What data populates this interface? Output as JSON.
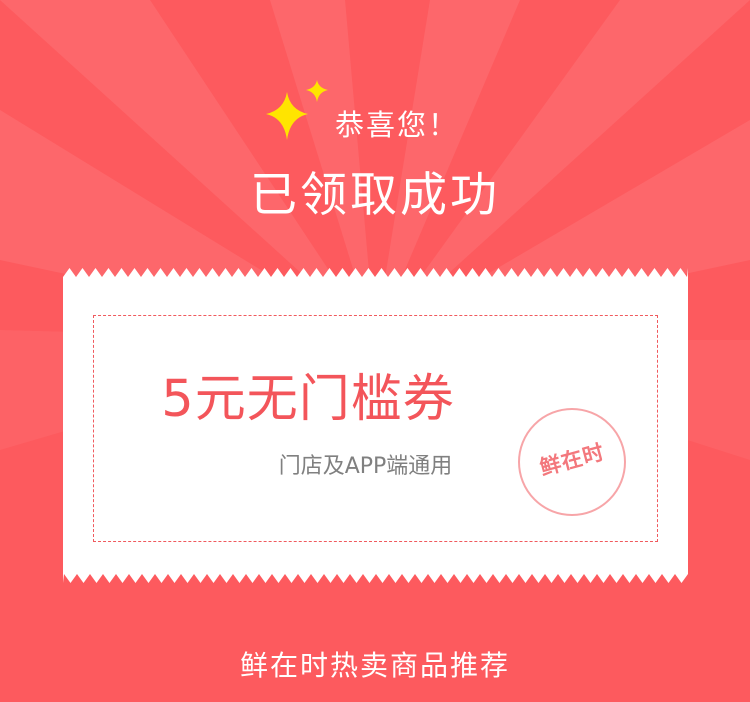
{
  "header": {
    "sparkle_icon": "sparkle-icon",
    "congrats_text": "恭喜您！",
    "title": "已领取成功"
  },
  "coupon": {
    "value_text": "5元无门槛券",
    "scope_text": "门店及APP端通用",
    "stamp_text": "鲜在时"
  },
  "footer": {
    "section_title": "鲜在时热卖商品推荐"
  },
  "colors": {
    "background": "#fd5a5e",
    "ray": "#ffffff",
    "coupon_bg": "#ffffff",
    "accent": "#f3555a",
    "sparkle": "#ffe400",
    "stamp": "#f7a5a8"
  }
}
